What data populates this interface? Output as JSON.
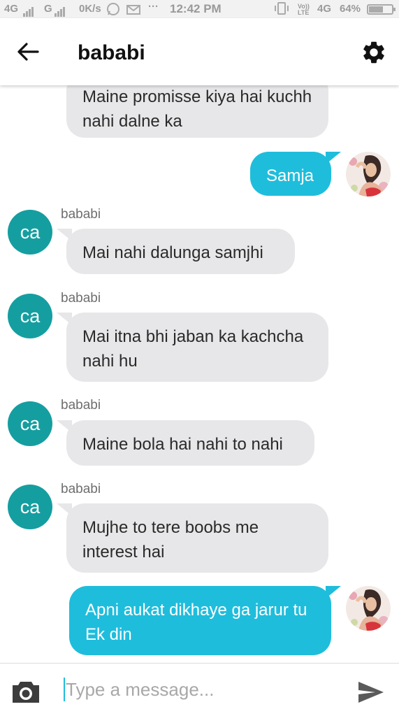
{
  "status_bar": {
    "network_1": "4G",
    "network_2": "G",
    "data_speed": "0K/s",
    "more": "···",
    "time": "12:42 PM",
    "volte": "Vo)) LTE",
    "network_3": "4G",
    "battery": "64%"
  },
  "header": {
    "title": "bababi",
    "back_icon": "arrow-left",
    "settings_icon": "gear"
  },
  "messages": [
    {
      "type": "received",
      "text": "Maine promisse kiya hai kuchh nahi dalne ka"
    },
    {
      "type": "sent",
      "text": "Samja"
    },
    {
      "type": "received",
      "sender": "bababi",
      "avatar": "ca",
      "text": "Mai nahi dalunga samjhi"
    },
    {
      "type": "received",
      "sender": "bababi",
      "avatar": "ca",
      "text": "Mai itna bhi jaban ka kachcha nahi hu"
    },
    {
      "type": "received",
      "sender": "bababi",
      "avatar": "ca",
      "text": "Maine bola hai nahi to nahi"
    },
    {
      "type": "received",
      "sender": "bababi",
      "avatar": "ca",
      "text": "Mujhe to tere boobs me interest hai"
    },
    {
      "type": "sent",
      "text": "Apni aukat dikhaye ga jarur tu Ek din"
    }
  ],
  "composer": {
    "placeholder": "Type a message...",
    "value": "",
    "camera_icon": "camera",
    "send_icon": "send"
  },
  "colors": {
    "sent_bubble": "#1fbddc",
    "received_bubble": "#e7e7e9",
    "avatar_bg": "#159ea0"
  }
}
